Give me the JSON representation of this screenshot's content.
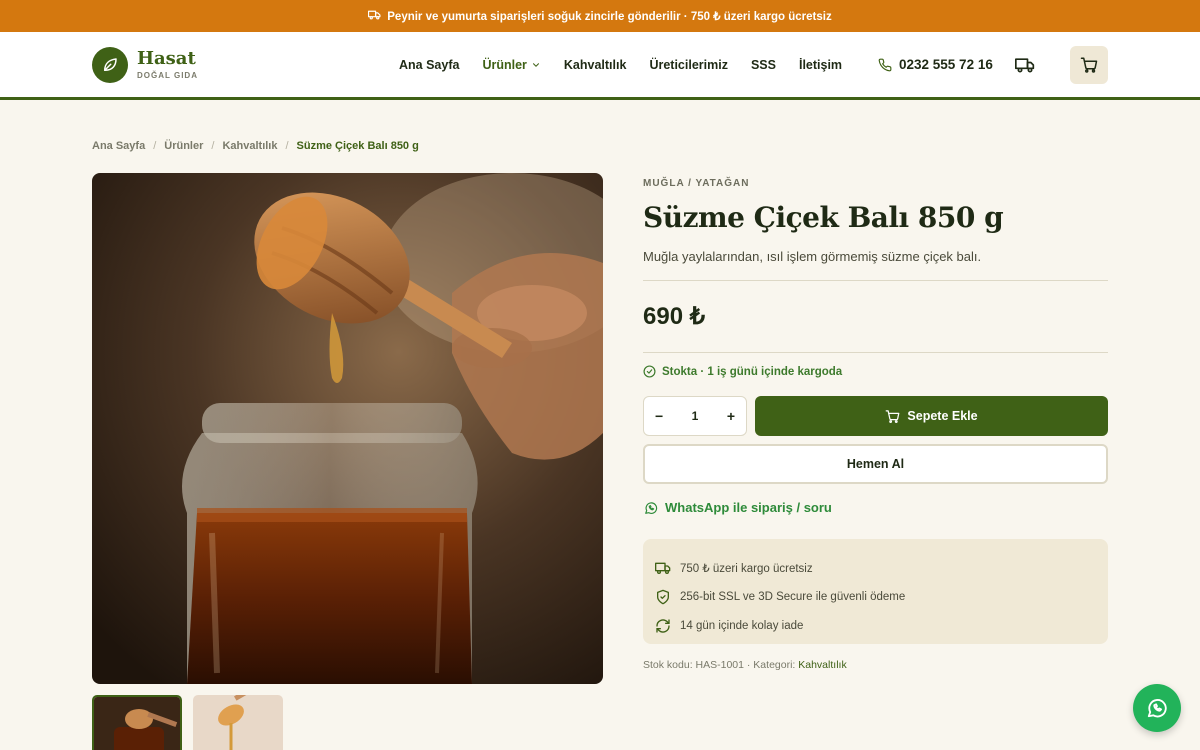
{
  "topbar": {
    "text": "Peynir ve yumurta siparişleri soğuk zincirle gönderilir · 750 ₺ üzeri kargo ücretsiz"
  },
  "brand": {
    "name": "Hasat",
    "tagline": "DOĞAL GIDA"
  },
  "nav": {
    "items": [
      "Ana Sayfa",
      "Ürünler",
      "Kahvaltılık",
      "Üreticilerimiz",
      "SSS",
      "İletişim"
    ],
    "active": "Ürünler"
  },
  "phone": "0232 555 72 16",
  "breadcrumb": [
    "Ana Sayfa",
    "Ürünler",
    "Kahvaltılık",
    "Süzme Çiçek Balı 850 g"
  ],
  "product": {
    "origin": "MUĞLA / YATAĞAN",
    "title": "Süzme Çiçek Balı 850 g",
    "description": "Muğla yaylalarından, ısıl işlem görmemiş süzme çiçek balı.",
    "price": "690 ₺",
    "stock": "Stokta · 1 iş günü içinde kargoda",
    "quantity": "1",
    "qty_minus": "−",
    "qty_plus": "+",
    "add_to_cart": "Sepete Ekle",
    "buy_now": "Hemen Al",
    "whatsapp": "WhatsApp ile sipariş / soru",
    "sku_label": "Stok kodu: HAS-1001 · Kategori: ",
    "category": "Kahvaltılık"
  },
  "features": [
    {
      "icon": "truck-icon",
      "text": "750 ₺ üzeri kargo ücretsiz"
    },
    {
      "icon": "shield-check-icon",
      "text": "256-bit SSL ve 3D Secure ile güvenli ödeme"
    },
    {
      "icon": "refresh-icon",
      "text": "14 gün içinde kolay iade"
    }
  ],
  "colors": {
    "brand_green": "#3f6116",
    "topbar_orange": "#d4780f",
    "stock_green": "#3d7a2c",
    "whatsapp_green": "#22b35a",
    "background": "#f9f6ee"
  }
}
